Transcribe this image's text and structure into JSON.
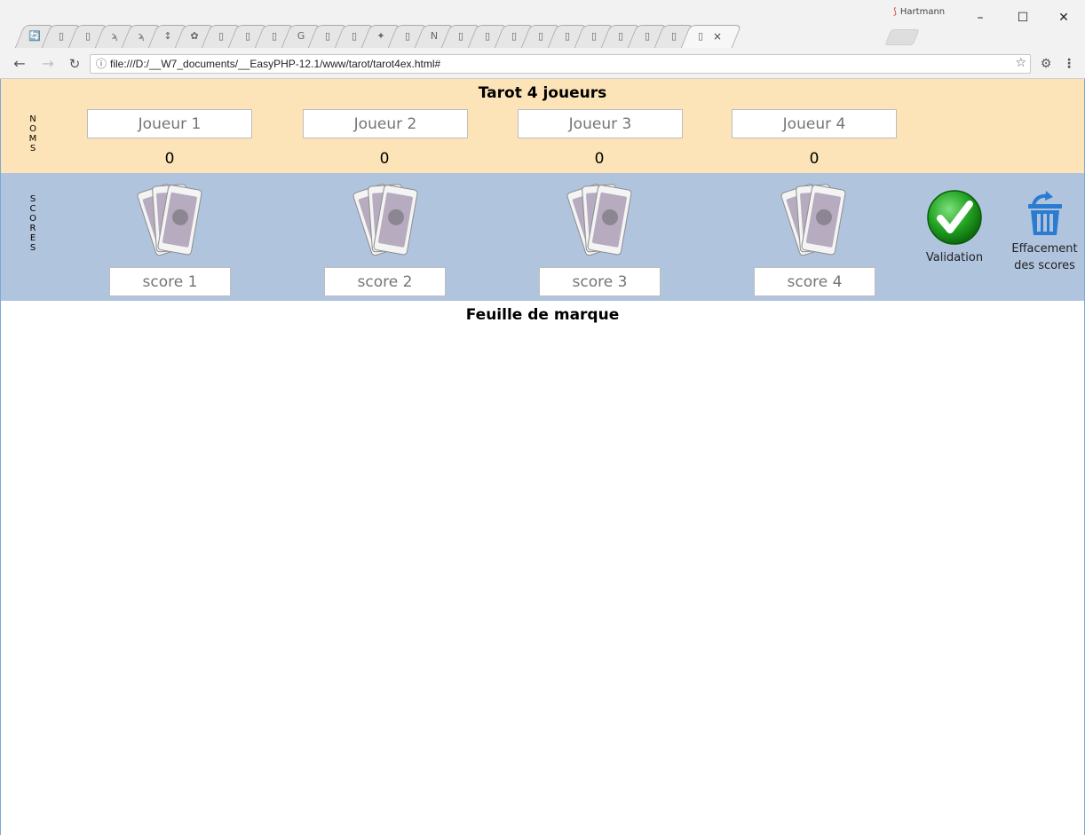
{
  "browser": {
    "profile_name": "Hartmann",
    "url": "file:///D:/__W7_documents/__EasyPHP-12.1/www/tarot/tarot4ex.html#",
    "tab_count": 26,
    "active_tab_close": "×"
  },
  "app": {
    "title": "Tarot 4 joueurs",
    "names_label": "NOMS",
    "scores_label": "SCORES",
    "players": [
      {
        "placeholder": "Joueur 1",
        "total": "0",
        "score_placeholder": "score 1"
      },
      {
        "placeholder": "Joueur 2",
        "total": "0",
        "score_placeholder": "score 2"
      },
      {
        "placeholder": "Joueur 3",
        "total": "0",
        "score_placeholder": "score 3"
      },
      {
        "placeholder": "Joueur 4",
        "total": "0",
        "score_placeholder": "score 4"
      }
    ],
    "validation_label": "Validation",
    "clear_label_line1": "Effacement",
    "clear_label_line2": "des scores",
    "sheet_title": "Feuille de marque"
  },
  "colors": {
    "names_bg": "#fde4b8",
    "scores_bg": "#b0c4de",
    "validate_green": "#2aa52a",
    "trash_blue": "#2b7bd0"
  }
}
